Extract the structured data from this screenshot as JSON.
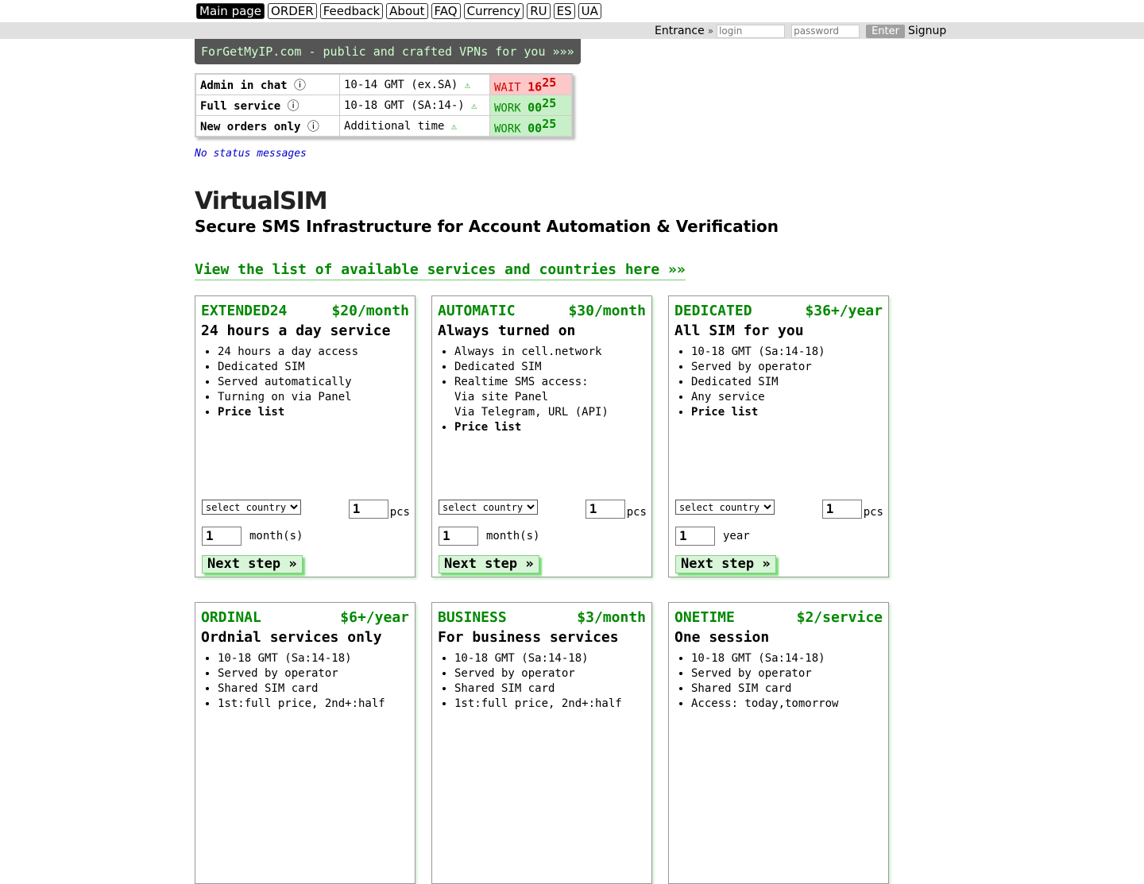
{
  "nav": {
    "items": [
      "Main page",
      "ORDER",
      "Feedback",
      "About",
      "FAQ",
      "Currency",
      "RU",
      "ES",
      "UA"
    ]
  },
  "login": {
    "entrance_label": "Entrance",
    "raquo": "»",
    "login_placeholder": "login",
    "password_placeholder": "password",
    "enter_label": "Enter",
    "signup_label": "Signup"
  },
  "banner": {
    "text": "ForGetMyIP.com - public and crafted VPNs for you »»»"
  },
  "status": {
    "rows": [
      {
        "label": "Admin in chat",
        "info": "ⓘ",
        "hours": "10-14 GMT (ex.SA)",
        "warn": "⚠",
        "state": "WAIT",
        "hh": "16",
        "mm": "25"
      },
      {
        "label": "Full service",
        "info": "ⓘ",
        "hours": "10-18 GMT (SA:14-)",
        "warn": "⚠",
        "state": "WORK",
        "hh": "00",
        "mm": "25"
      },
      {
        "label": "New orders only",
        "info": "ⓘ",
        "hours": "Additional time",
        "warn": "⚠",
        "state": "WORK",
        "hh": "00",
        "mm": "25"
      }
    ],
    "message": "No status messages"
  },
  "page": {
    "title": "VirtualSIM",
    "subtitle": "Secure SMS Infrastructure for Account Automation & Verification",
    "view_link": "View the list of available services and countries here »»"
  },
  "plans": [
    {
      "name": "EXTENDED24",
      "price": "$20/month",
      "tagline": "24 hours a day service",
      "features": [
        "24 hours a day access",
        "Dedicated SIM",
        "Served automatically",
        "Turning on via Panel"
      ],
      "price_list": "Price list",
      "country_select": "select country",
      "qty": "1",
      "qty_unit": "pcs",
      "period_value": "1",
      "period_unit": "month(s)",
      "next_label": "Next step »"
    },
    {
      "name": "AUTOMATIC",
      "price": "$30/month",
      "tagline": "Always turned on",
      "features": [
        "Always in cell.network",
        "Dedicated SIM",
        "Realtime SMS access:"
      ],
      "sub_lines": [
        "Via site Panel",
        "Via Telegram, URL (API)"
      ],
      "price_list": "Price list",
      "country_select": "select country",
      "qty": "1",
      "qty_unit": "pcs",
      "period_value": "1",
      "period_unit": "month(s)",
      "next_label": "Next step »"
    },
    {
      "name": "DEDICATED",
      "price": "$36+/year",
      "tagline": "All SIM for you",
      "features": [
        "10-18 GMT (Sa:14-18)",
        "Served by operator",
        "Dedicated SIM",
        "Any service"
      ],
      "price_list": "Price list",
      "country_select": "select country",
      "qty": "1",
      "qty_unit": "pcs",
      "period_value": "1",
      "period_unit": "year",
      "next_label": "Next step »"
    },
    {
      "name": "ORDINAL",
      "price": "$6+/year",
      "tagline": "Ordnial services only",
      "features": [
        "10-18 GMT (Sa:14-18)",
        "Served by operator",
        "Shared SIM card",
        "1st:full price, 2nd+:half"
      ]
    },
    {
      "name": "BUSINESS",
      "price": "$3/month",
      "tagline": "For business services",
      "features": [
        "10-18 GMT (Sa:14-18)",
        "Served by operator",
        "Shared SIM card",
        "1st:full price, 2nd+:half"
      ]
    },
    {
      "name": "ONETIME",
      "price": "$2/service",
      "tagline": "One session",
      "features": [
        "10-18 GMT (Sa:14-18)",
        "Served by operator",
        "Shared SIM card",
        "Access: today,tomorrow"
      ]
    }
  ]
}
